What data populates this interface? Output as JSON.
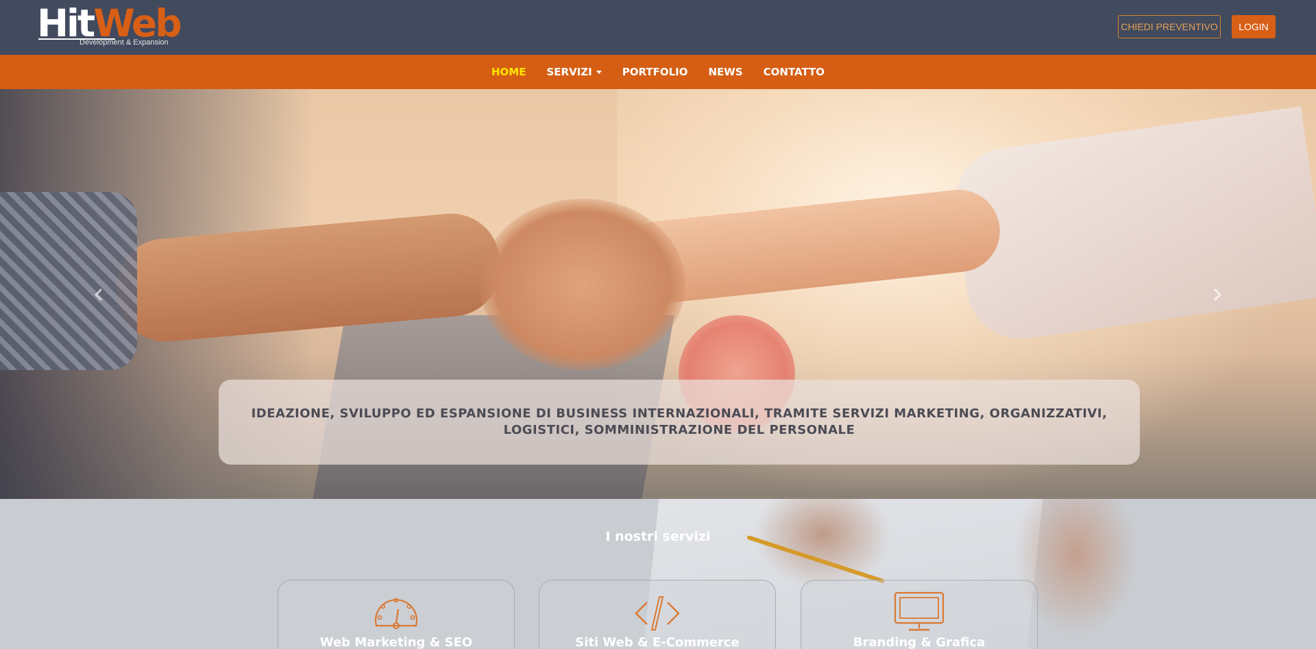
{
  "header": {
    "logo": {
      "main_part1": "Hit",
      "main_part2": "Web",
      "tagline": "Development & Expansion"
    },
    "quote_button": "CHIEDI PREVENTIVO",
    "login_button": "LOGIN",
    "colors": {
      "bar": "#424a5e",
      "accent": "#d75f16"
    }
  },
  "nav": {
    "items": [
      {
        "label": "HOME",
        "active": true
      },
      {
        "label": "SERVIZI",
        "has_dropdown": true
      },
      {
        "label": "PORTFOLIO"
      },
      {
        "label": "NEWS"
      },
      {
        "label": "CONTATTO"
      }
    ],
    "colors": {
      "bar": "#d55e14",
      "active": "#ffe600"
    }
  },
  "hero": {
    "caption": "IDEAZIONE, SVILUPPO ED ESPANSIONE DI BUSINESS INTERNAZIONALI, TRAMITE SERVIZI MARKETING, ORGANIZZATIVI, LOGISTICI, SOMMINISTRAZIONE DEL PERSONALE",
    "prev_icon": "chevron-left-icon",
    "next_icon": "chevron-right-icon"
  },
  "services": {
    "title": "I nostri servizi",
    "cards": [
      {
        "title": "Web Marketing & SEO",
        "icon": "speedometer-icon"
      },
      {
        "title": "Siti Web & E-Commerce",
        "icon": "code-icon"
      },
      {
        "title": "Branding & Grafica",
        "icon": "monitor-icon"
      }
    ]
  }
}
